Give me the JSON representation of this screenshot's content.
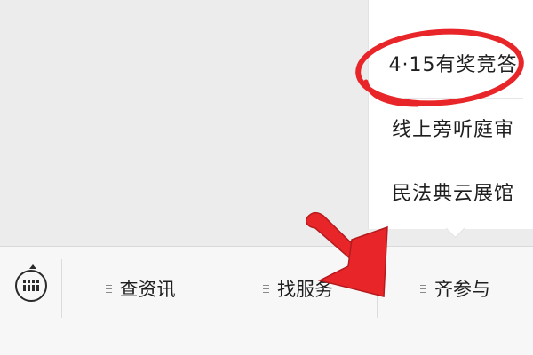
{
  "popup_menu": {
    "items": [
      {
        "label": "4·15有奖竞答"
      },
      {
        "label": "线上旁听庭审"
      },
      {
        "label": "民法典云展馆"
      }
    ]
  },
  "bottom_bar": {
    "keyboard_icon": "keyboard-icon",
    "menus": [
      {
        "label": "查资讯",
        "icon": "hamburger-icon"
      },
      {
        "label": "找服务",
        "icon": "hamburger-icon"
      },
      {
        "label": "齐参与",
        "icon": "hamburger-icon"
      }
    ]
  },
  "annotations": {
    "highlight_color": "#e8262a",
    "circle_target": "4·15有奖竞答",
    "arrow_target": "齐参与"
  },
  "colors": {
    "background": "#ececec",
    "popup_bg": "#ffffff",
    "bar_bg": "#f7f7f7",
    "text": "#1f1f1f"
  }
}
